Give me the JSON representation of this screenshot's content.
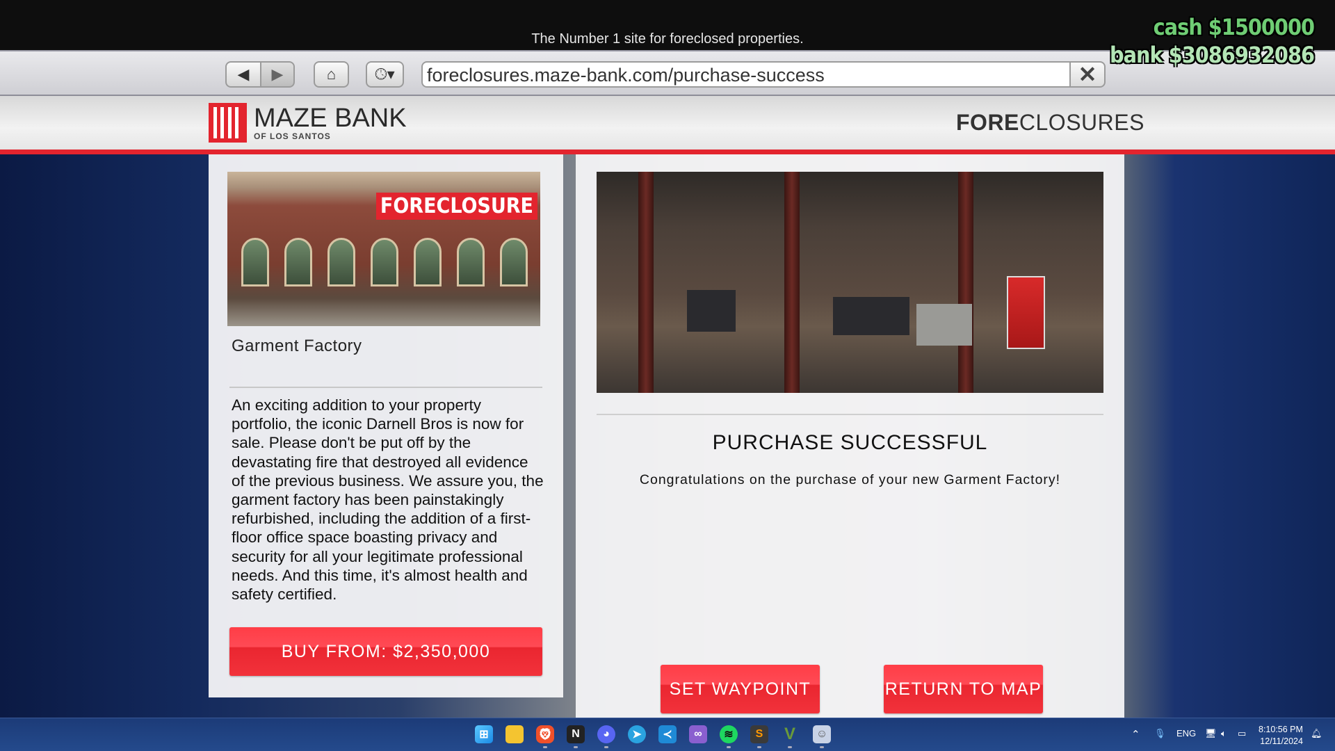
{
  "browser": {
    "tagline": "The Number 1 site for foreclosed properties.",
    "url": "foreclosures.maze-bank.com/purchase-success",
    "close_glyph": "✕"
  },
  "hud": {
    "cash": "cash $1500000",
    "bank": "bank $3086932086",
    "cash_color": "#6fcd74",
    "bank_color": "#b4e6b6"
  },
  "site": {
    "logo_name": "MAZE BANK",
    "logo_sub": "OF LOS SANTOS",
    "section_bold": "FORE",
    "section_light": "CLOSURES",
    "accent": "#e3242e"
  },
  "property": {
    "image_sign": "FORECLOSURE",
    "title": "Garment Factory",
    "description": "An exciting addition to your property portfolio, the iconic Darnell Bros is now for sale. Please don't be put off by the devastating fire that destroyed all evidence of the previous business. We assure you, the garment factory has been painstakingly refurbished, including the addition of a first-floor office space boasting privacy and security for all your legitimate professional needs. And this time, it's almost health and safety certified.",
    "buy_label": "BUY FROM: $2,350,000"
  },
  "result": {
    "heading": "PURCHASE SUCCESSFUL",
    "message": "Congratulations on the purchase of your new Garment Factory!",
    "waypoint_label": "SET WAYPOINT",
    "return_label": "RETURN TO MAP"
  },
  "taskbar": {
    "apps": [
      "windows-start",
      "file-explorer",
      "brave",
      "notion",
      "discord",
      "telegram",
      "vscode",
      "visual-studio",
      "spotify",
      "sublime-text",
      "gta-v",
      "profile-app"
    ],
    "language": "ENG",
    "time": "8:10:56 PM",
    "date": "12/11/2024"
  }
}
